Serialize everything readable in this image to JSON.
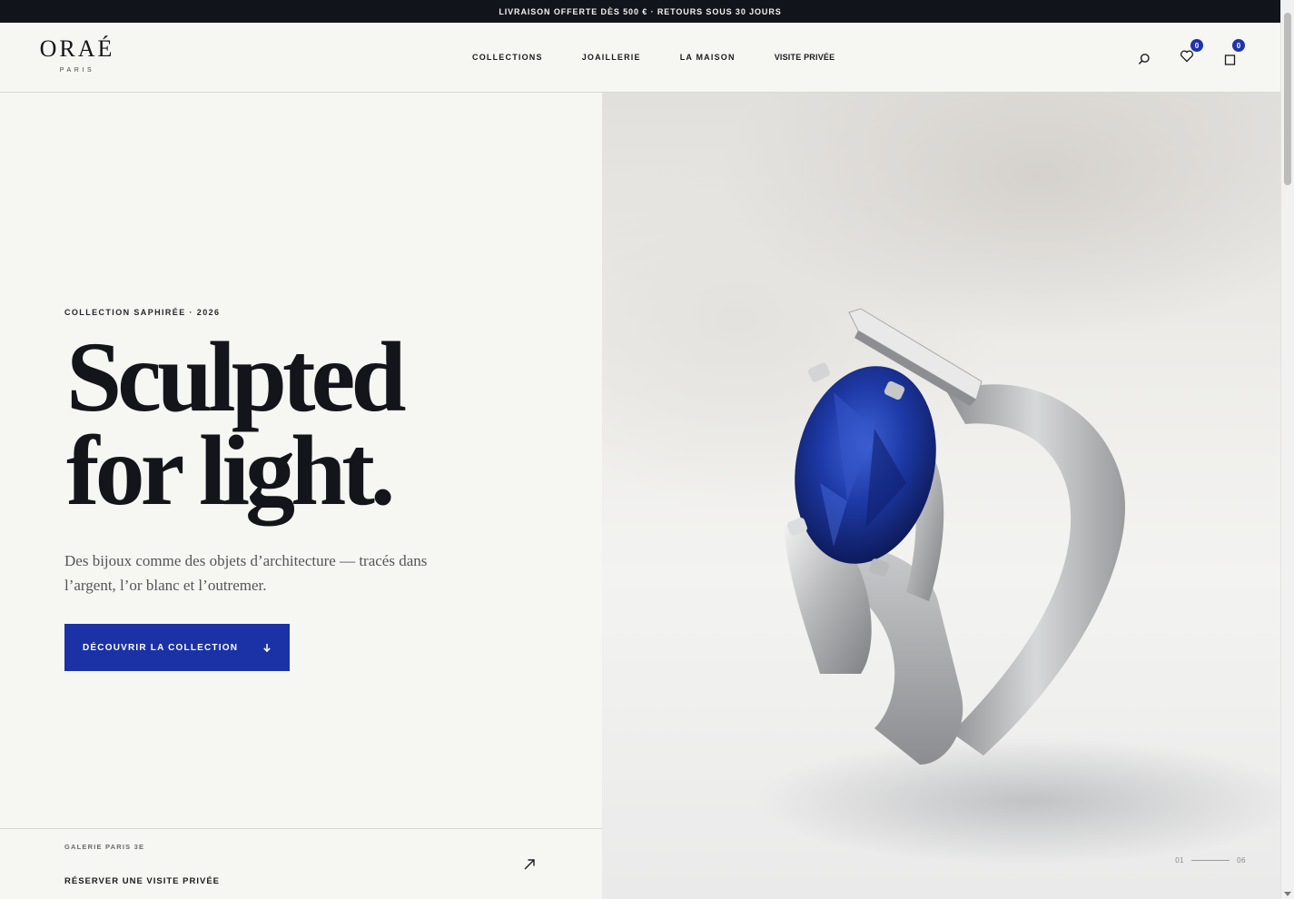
{
  "announcement": "LIVRAISON OFFERTE DÈS 500 € · RETOURS SOUS 30 JOURS",
  "brand": {
    "name": "ORAÉ",
    "subtitle": "PARIS"
  },
  "nav": {
    "items": [
      {
        "label": "COLLECTIONS"
      },
      {
        "label": "JOAILLERIE"
      },
      {
        "label": "LA MAISON"
      },
      {
        "label": "VISITE PRIVÉE"
      }
    ]
  },
  "header_icons": {
    "search": {
      "icon": "search-icon"
    },
    "wishlist": {
      "icon": "heart-icon",
      "count": "0"
    },
    "bag": {
      "icon": "bag-icon",
      "count": "0"
    }
  },
  "hero": {
    "eyebrow": "COLLECTION SAPHIRÉE · 2026",
    "headline_line1": "Sculpted",
    "headline_line2": "for light.",
    "lede": "Des bijoux comme des objets d’architecture — tracés dans l’argent, l’or blanc et l’outremer.",
    "cta_label": "DÉCOUVRIR LA COLLECTION",
    "cta_icon": "arrow-down-icon"
  },
  "gallery": {
    "label": "GALERIE PARIS 3E",
    "link": "RÉSERVER UNE VISITE PRIVÉE",
    "icon": "arrow-up-right-icon"
  },
  "slider": {
    "current": "01",
    "total": "06"
  },
  "colors": {
    "accent": "#1a32a6",
    "announcement_bg": "#12141c",
    "page_bg": "#f6f6f2",
    "sapphire": "#1e3aa8"
  }
}
